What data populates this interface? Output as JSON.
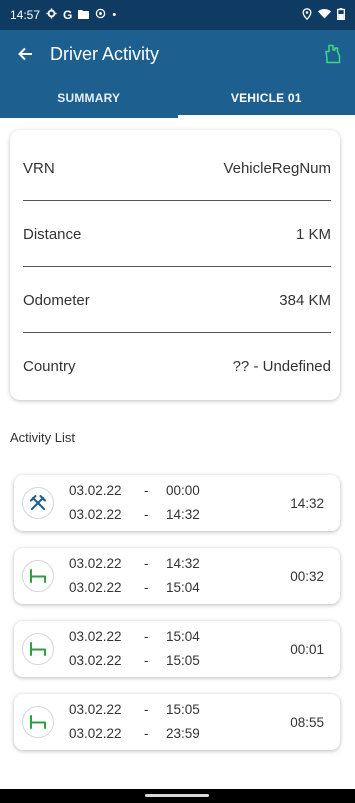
{
  "status_bar": {
    "time": "14:57",
    "left_icons": [
      "gear-icon",
      "google-g-icon",
      "folder-icon",
      "settings-icon",
      "dot-icon"
    ],
    "right_icons": [
      "location-icon",
      "wifi-icon",
      "battery-icon"
    ]
  },
  "app_bar": {
    "title": "Driver Activity",
    "back_icon": "arrow-back-icon",
    "action_icon": "gloves-icon",
    "action_color": "#3ddc84",
    "background": "#1d5f8f"
  },
  "tabs": [
    {
      "label": "SUMMARY",
      "active": false
    },
    {
      "label": "VEHICLE 01",
      "active": true
    }
  ],
  "vehicle_info": [
    {
      "label": "VRN",
      "value": "VehicleRegNum"
    },
    {
      "label": "Distance",
      "value": "1 KM"
    },
    {
      "label": "Odometer",
      "value": "384 KM"
    },
    {
      "label": "Country",
      "value": "?? - Undefined"
    }
  ],
  "activity_list": {
    "title": "Activity List",
    "items": [
      {
        "icon": "crossed-hammers-work-icon",
        "icon_color": "#1d5f8f",
        "start_date": "03.02.22",
        "start_time": "00:00",
        "end_date": "03.02.22",
        "end_time": "14:32",
        "duration": "14:32"
      },
      {
        "icon": "bed-rest-icon",
        "icon_color": "#2e9e3e",
        "start_date": "03.02.22",
        "start_time": "14:32",
        "end_date": "03.02.22",
        "end_time": "15:04",
        "duration": "00:32"
      },
      {
        "icon": "bed-rest-icon",
        "icon_color": "#2e9e3e",
        "start_date": "03.02.22",
        "start_time": "15:04",
        "end_date": "03.02.22",
        "end_time": "15:05",
        "duration": "00:01"
      },
      {
        "icon": "bed-rest-icon",
        "icon_color": "#2e9e3e",
        "start_date": "03.02.22",
        "start_time": "15:05",
        "end_date": "03.02.22",
        "end_time": "23:59",
        "duration": "08:55"
      }
    ],
    "separator": "-"
  }
}
